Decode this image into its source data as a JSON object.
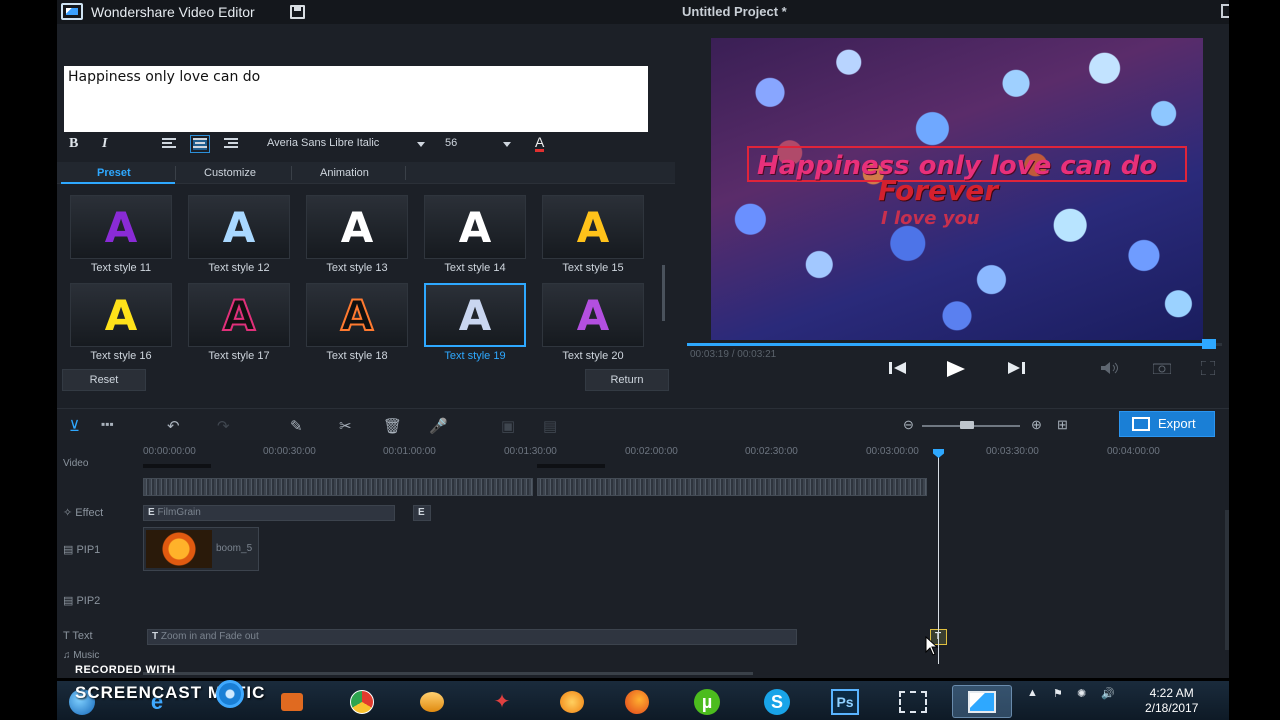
{
  "window": {
    "app_name": "Wondershare Video Editor",
    "project_title": "Untitled Project *"
  },
  "text_editor": {
    "content": "Happiness only love can do",
    "bold_label": "B",
    "italic_label": "I",
    "font_name": "Averia Sans Libre Italic",
    "font_size": "56",
    "color_label": "A",
    "font_color": "#e03030"
  },
  "tabs": [
    "Preset",
    "Customize",
    "Animation"
  ],
  "active_tab": "Preset",
  "text_styles": [
    {
      "label": "Text style 11",
      "glyph": "A",
      "color": "#8a2bd6"
    },
    {
      "label": "Text style 12",
      "glyph": "A",
      "color": "#a9d8ff"
    },
    {
      "label": "Text style 13",
      "glyph": "A",
      "color": "#ffffff"
    },
    {
      "label": "Text style 14",
      "glyph": "A",
      "color": "#ffffff"
    },
    {
      "label": "Text style 15",
      "glyph": "A",
      "color": "#ffc21a"
    },
    {
      "label": "Text style 16",
      "glyph": "A",
      "color": "#ffe21a"
    },
    {
      "label": "Text style 17",
      "glyph": "A",
      "color": "#111111"
    },
    {
      "label": "Text style 18",
      "glyph": "A",
      "color": "#111111"
    },
    {
      "label": "Text style 19",
      "glyph": "A",
      "color": "#c9d6f0"
    },
    {
      "label": "Text style 20",
      "glyph": "A",
      "color": "#b34fe0"
    }
  ],
  "selected_style": "Text style 19",
  "buttons": {
    "reset": "Reset",
    "return": "Return",
    "export": "Export"
  },
  "preview": {
    "caption_line1": "Happiness only love can do",
    "caption_line2": "Forever",
    "caption_line3": "I love you",
    "timecode": "00:03:19 / 00:03:21",
    "progress": 0.985
  },
  "ruler_ticks": [
    "00:00:00:00",
    "00:00:30:00",
    "00:01:00:00",
    "00:01:30:00",
    "00:02:00:00",
    "00:02:30:00",
    "00:03:00:00",
    "00:03:30:00",
    "00:04:00:00"
  ],
  "tracks": {
    "video": "Video",
    "effect": "Effect",
    "pip1": "PIP1",
    "pip2": "PIP2",
    "text": "Text",
    "music": "Music"
  },
  "clips": {
    "effect_name": "FilmGrain",
    "effect_badge": "E",
    "effect_marker": "E",
    "pip_clip": "boom_5",
    "text_clip": "Zoom in and Fade out",
    "text_badge": "T",
    "text_marker": "T"
  },
  "watermark": {
    "line1": "RECORDED WITH",
    "line2": "SCREENCAST  MATIC"
  },
  "taskbar": {
    "time": "4:22 AM",
    "date": "2/18/2017",
    "apps": [
      "windows-start",
      "internet-explorer",
      "screencast",
      "chrome",
      "app-globe",
      "app-red",
      "app-orange",
      "firefox",
      "utorrent",
      "skype",
      "photoshop",
      "snipping-tool",
      "video-editor"
    ],
    "ps_label": "Ps"
  },
  "colors": {
    "accent": "#2ea8ff",
    "export_bg": "#1a7fd6",
    "caption_border": "#e0243a"
  }
}
